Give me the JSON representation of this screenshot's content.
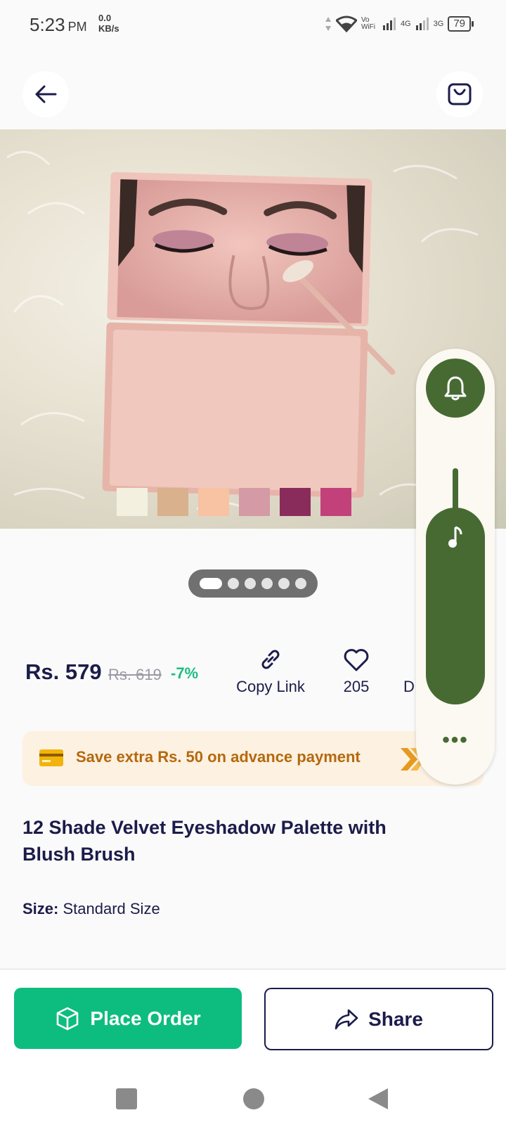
{
  "status_bar": {
    "time": "5:23",
    "ampm": "PM",
    "speed_value": "0.0",
    "speed_unit": "KB/s",
    "vowifi": "Vo WiFi",
    "net1": "4G",
    "net2": "3G",
    "battery": "79"
  },
  "product": {
    "price": "Rs. 579",
    "mrp": "Rs. 619",
    "discount": "-7%",
    "title": "12 Shade Velvet Eyeshadow Palette with Blush Brush",
    "size_label": "Size:",
    "size_value": "Standard Size",
    "image_count": 6,
    "active_image": 1
  },
  "actions": {
    "copy_link": "Copy Link",
    "wishlist_count": "205",
    "download_partial": "D"
  },
  "offer": {
    "text": "Save extra Rs. 50 on advance payment"
  },
  "buttons": {
    "place_order": "Place Order",
    "share": "Share"
  },
  "colors": {
    "primary_green": "#0dbd7f",
    "navy": "#1b1c4a",
    "offer_text": "#b4690e",
    "volume_green": "#476a33"
  },
  "volume_panel": {
    "more": "•••"
  }
}
